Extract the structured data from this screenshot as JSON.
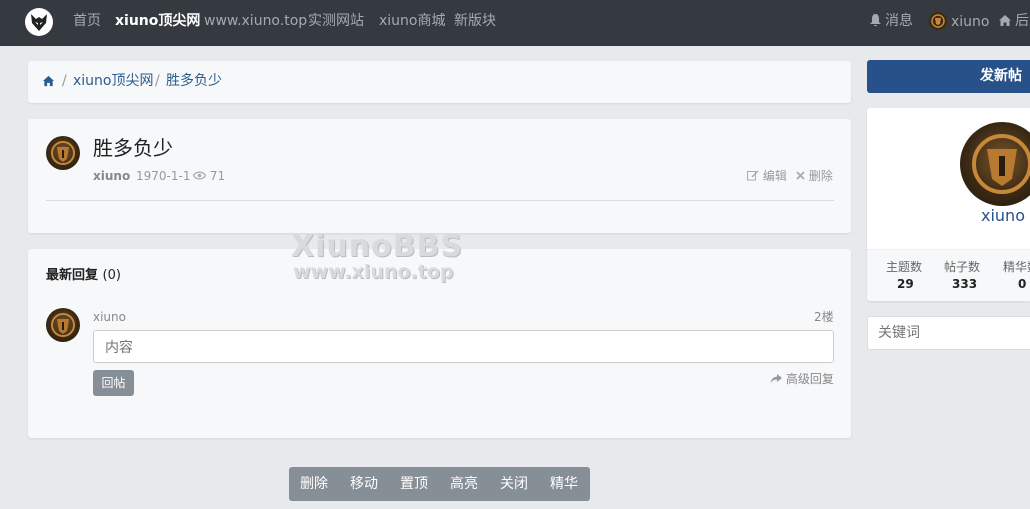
{
  "nav": {
    "items": [
      "首页",
      "xiuno顶尖网",
      "www.xiuno.top",
      "实测网站",
      "xiuno商城",
      "新版块"
    ],
    "messages": "消息",
    "user": "xiuno",
    "admin": "后"
  },
  "breadcrumb": {
    "forum": "xiuno顶尖网",
    "thread": "胜多负少",
    "sep": "/"
  },
  "thread": {
    "title": "胜多负少",
    "author": "xiuno",
    "date": "1970-1-1",
    "views": "71",
    "edit": "编辑",
    "delete": "删除"
  },
  "replies": {
    "title": "最新回复",
    "count": "(0)",
    "user": "xiuno",
    "floor": "2楼",
    "placeholder": "内容",
    "submit": "回帖",
    "advanced": "高级回复"
  },
  "watermark": {
    "line1": "XiunoBBS",
    "line2": "www.xiuno.top"
  },
  "moderation": [
    "删除",
    "移动",
    "置顶",
    "高亮",
    "关闭",
    "精华"
  ],
  "sidebar": {
    "new_thread": "发新帖",
    "username": "xiuno",
    "stats": [
      {
        "label": "主题数",
        "value": "29"
      },
      {
        "label": "帖子数",
        "value": "333"
      },
      {
        "label": "精华数",
        "value": "0"
      }
    ],
    "search_placeholder": "关键词"
  },
  "colors": {
    "navbar": "#343a40",
    "primary": "#28518a",
    "secondary": "#868e96",
    "link": "#2a5d8f"
  }
}
